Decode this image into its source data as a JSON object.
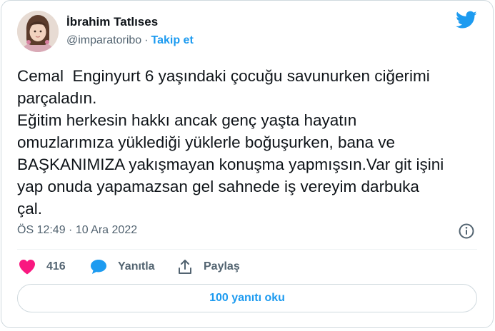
{
  "tweet": {
    "author_name": "İbrahim Tatlıses",
    "handle": "@imparatoribo",
    "separator": "·",
    "follow_label": "Takip et",
    "text": "Cemal  Enginyurt 6 yaşındaki çocuğu savunurken ciğerimi\nparçaladın.\nEğitim herkesin hakkı ancak genç yaşta hayatın\nomuzlarımıza yüklediği yüklerle boğuşurken, bana ve\nBAŞKANIMIZA yakışmayan konuşma yapmışsın.Var git işini\nyap onuda yapamazsan gel sahnede iş vereyim darbuka\nçal.",
    "timestamp": "ÖS 12:49 · 10 Ara 2022"
  },
  "actions": {
    "like_count": "416",
    "reply_label": "Yanıtla",
    "share_label": "Paylaş"
  },
  "replies_button_label": "100 yanıtı oku",
  "icons": {
    "logo": "twitter-bird-icon",
    "info": "info-icon",
    "like": "heart-icon",
    "reply": "speech-bubble-icon",
    "share": "share-icon"
  },
  "colors": {
    "accent": "#1d9bf0",
    "like": "#f91880",
    "muted": "#536471",
    "text": "#0f1419",
    "border": "#cfd9de"
  }
}
